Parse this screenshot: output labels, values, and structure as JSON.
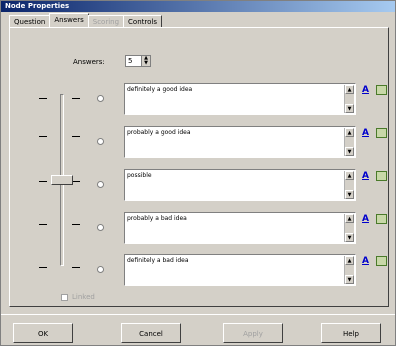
{
  "window": {
    "title": "Node Properties"
  },
  "tabs": [
    {
      "label": "Question",
      "state": "normal"
    },
    {
      "label": "Answers",
      "state": "active"
    },
    {
      "label": "Scoring",
      "state": "disabled"
    },
    {
      "label": "Controls",
      "state": "normal"
    }
  ],
  "answers_field": {
    "label": "Answers:",
    "value": "5"
  },
  "answers": [
    {
      "text": "definitely a good idea"
    },
    {
      "text": "probably a good idea"
    },
    {
      "text": "possible"
    },
    {
      "text": "probably a bad idea"
    },
    {
      "text": "definitely a bad idea"
    }
  ],
  "bold_label": "A",
  "checkbox": {
    "label": "Linked",
    "checked": false,
    "enabled": false
  },
  "buttons": {
    "ok": "OK",
    "cancel": "Cancel",
    "apply": "Apply",
    "help": "Help"
  },
  "colors": {
    "title_start": "#0a246a",
    "title_end": "#a6caf0",
    "face": "#d4d0c8"
  }
}
